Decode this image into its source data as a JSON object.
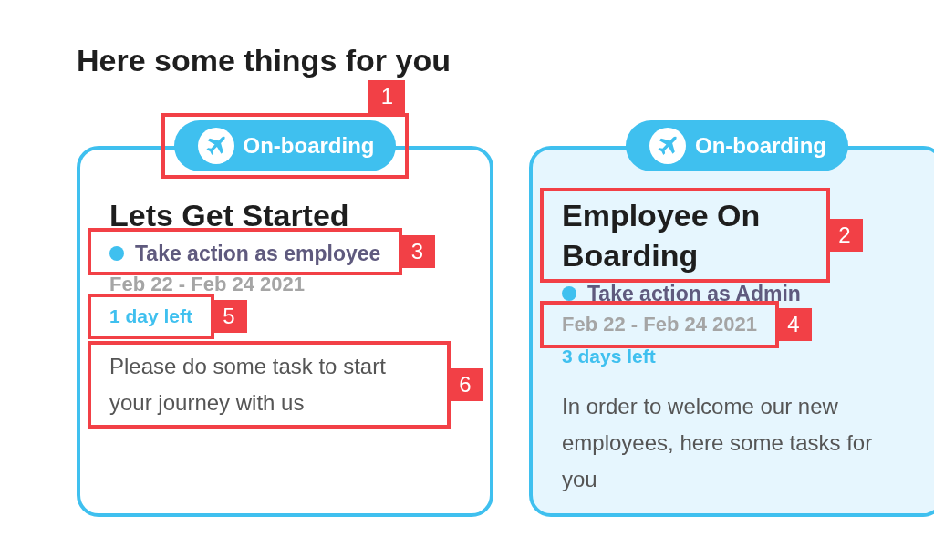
{
  "heading": "Here some things for you",
  "cards": [
    {
      "highlighted": false,
      "tag": "On-boarding",
      "tag_callout": "1",
      "title": "Lets Get Started",
      "role": "Take action as employee",
      "role_callout": "3",
      "dates": "Feb 22 - Feb 24 2021",
      "remaining": "1 day left",
      "remaining_callout": "5",
      "description": "Please do some task to start your journey with us",
      "description_callout": "6"
    },
    {
      "highlighted": true,
      "tag": "On-boarding",
      "title": "Employee On Boarding",
      "title_callout": "2",
      "role": "Take action as Admin",
      "dates": "Feb 22 - Feb 24 2021",
      "dates_callout": "4",
      "remaining": "3 days left",
      "description": "In order to welcome our new employees, here some tasks for you"
    }
  ]
}
